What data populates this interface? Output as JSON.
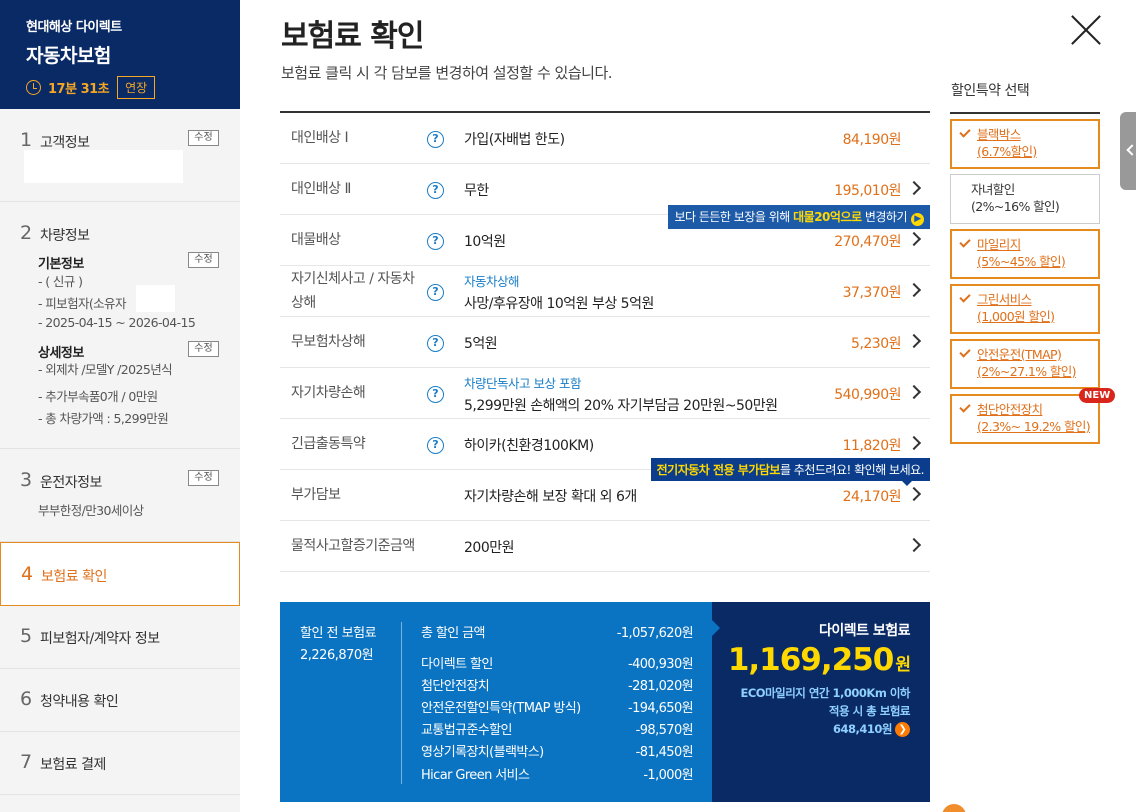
{
  "brand": {
    "company": "현대해상 다이렉트",
    "product": "자동차보험",
    "timer": "17분 31초",
    "extend_label": "연장"
  },
  "steps": [
    {
      "num": "1",
      "title": "고객정보",
      "edit": "수정"
    },
    {
      "num": "2",
      "title": "차량정보",
      "edit_basic": "수정",
      "edit_detail": "수정",
      "basic_head": "기본정보",
      "basic_lines": [
        "- ( 신규 )",
        "- 피보험자(소유자",
        "- 2025-04-15 ~ 2026-04-15"
      ],
      "detail_head": "상세정보",
      "detail_lines": [
        "- 외제차 /모델Y /2025년식",
        "- 추가부속품0개 / 0만원",
        "- 총 차량가액 : 5,299만원"
      ]
    },
    {
      "num": "3",
      "title": "운전자정보",
      "edit": "수정",
      "sub": "부부한정/만30세이상"
    },
    {
      "num": "4",
      "title": "보험료 확인"
    },
    {
      "num": "5",
      "title": "피보험자/계약자 정보"
    },
    {
      "num": "6",
      "title": "청약내용 확인"
    },
    {
      "num": "7",
      "title": "보험료 결제"
    }
  ],
  "main": {
    "title": "보험료 확인",
    "desc": "보험료 클릭 시 각 담보를 변경하여 설정할 수 있습니다."
  },
  "coverages": [
    {
      "label": "대인배상 Ⅰ",
      "value": "가입(자배법 한도)",
      "note": "",
      "price": "84,190원"
    },
    {
      "label": "대인배상 Ⅱ",
      "value": "무한",
      "note": "",
      "price": "195,010원"
    },
    {
      "label": "대물배상",
      "value": "10억원",
      "note": "",
      "price": "270,470원"
    },
    {
      "label": "자기신체사고 / 자동차상해",
      "value": "사망/후유장애 10억원 부상 5억원",
      "note": "자동차상해",
      "price": "37,370원"
    },
    {
      "label": "무보험차상해",
      "value": "5억원",
      "note": "",
      "price": "5,230원"
    },
    {
      "label": "자기차량손해",
      "value": "5,299만원 손해액의 20% 자기부담금 20만원~50만원",
      "note": "차량단독사고 보상 포함",
      "price": "540,990원"
    },
    {
      "label": "긴급출동특약",
      "value": "하이카(친환경100KM)",
      "note": "",
      "price": "11,820원"
    },
    {
      "label": "부가담보",
      "value": "자기차량손해 보장 확대 외 6개",
      "note": "",
      "price": "24,170원"
    },
    {
      "label": "물적사고할증기준금액",
      "value": "200만원",
      "note": "",
      "price": ""
    }
  ],
  "tips": {
    "tip1_pre": "보다 든든한 보장을 위해 ",
    "tip1_hl": "대물20억으로",
    "tip1_post": " 변경하기",
    "tip2_hl": "전기자동차 전용 부가담보",
    "tip2_post": "를 추천드려요! 확인해 보세요."
  },
  "summary": {
    "pre_label": "할인 전 보험료",
    "pre_value": "2,226,870원",
    "total_label": "총 할인 금액",
    "total_value": "-1,057,620원",
    "discounts": [
      {
        "label": "다이렉트 할인",
        "amount": "-400,930원"
      },
      {
        "label": "첨단안전장치",
        "amount": "-281,020원"
      },
      {
        "label": "안전운전할인특약(TMAP 방식)",
        "amount": "-194,650원"
      },
      {
        "label": "교통법규준수할인",
        "amount": "-98,570원"
      },
      {
        "label": "영상기록장치(블랙박스)",
        "amount": "-81,450원"
      },
      {
        "label": "Hicar Green 서비스",
        "amount": "-1,000원"
      }
    ],
    "final_label": "다이렉트 보험료",
    "final_amount": "1,169,250",
    "final_unit": "원",
    "eco_line1": "ECO마일리지 연간 1,000Km 이하",
    "eco_line2": "적용 시 총 보험료",
    "eco_value": "648,410원"
  },
  "discount_panel": {
    "title": "할인특약 선택",
    "options": [
      {
        "name": "블랙박스",
        "rate": "(6.7%할인)",
        "selected": true
      },
      {
        "name": "자녀할인",
        "rate": "(2%~16% 할인)",
        "selected": false
      },
      {
        "name": "마일리지",
        "rate": "(5%~45% 할인)",
        "selected": true
      },
      {
        "name": "그린서비스",
        "rate": "(1,000원 할인)",
        "selected": true
      },
      {
        "name": "안전운전(TMAP)",
        "rate": "(2%~27.1% 할인)",
        "selected": true
      },
      {
        "name": "첨단안전장치",
        "rate": "(2.3%~ 19.2% 할인)",
        "selected": true
      }
    ],
    "new_badge": "NEW"
  },
  "colors": {
    "navy": "#0a2a66",
    "blue": "#0a73c2",
    "orange": "#e0701a",
    "yellow": "#ffd800"
  }
}
